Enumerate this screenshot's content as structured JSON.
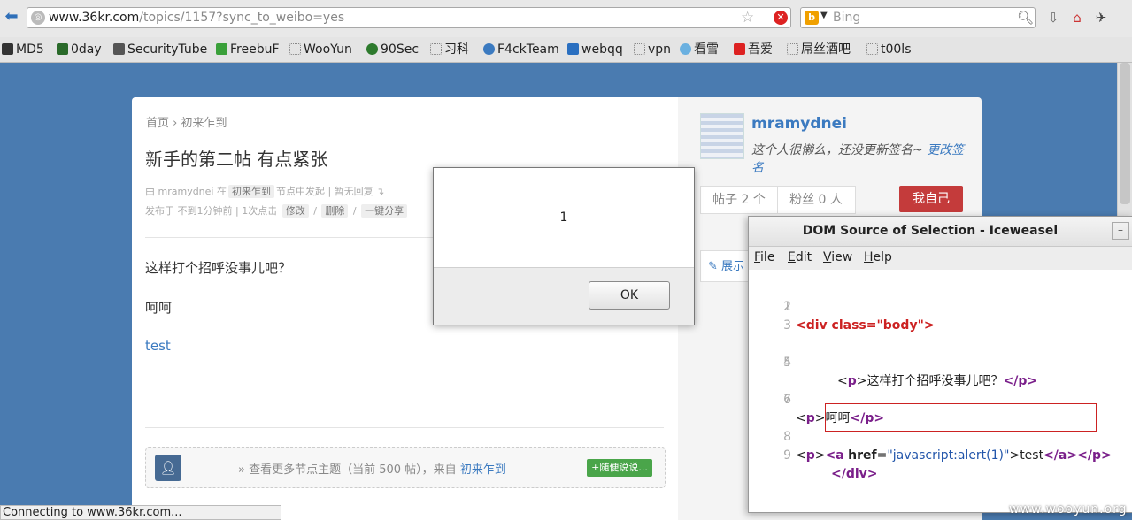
{
  "browser": {
    "url_host": "www.36kr.com",
    "url_path": "/topics/1157?sync_to_weibo=yes",
    "search_engine": "Bing",
    "bookmarks": [
      "MD5",
      "0day",
      "SecurityTube",
      "FreebuF",
      "WooYun",
      "90Sec",
      "习科",
      "F4ckTeam",
      "webqq",
      "vpn",
      "看雪",
      "吾爱",
      "屌丝酒吧",
      "t00ls"
    ],
    "status_text": "Connecting to www.36kr.com..."
  },
  "topic": {
    "breadcrumb": "首页 › 初来乍到",
    "title": "新手的第二帖 有点紧张",
    "meta_by": "由 mramydnei 在",
    "meta_node": "初来乍到",
    "meta_rest": "节点中发起 | 暂无回复 ↴",
    "meta_time": "发布于 不到1分钟前 | 1次点击",
    "edit": "修改",
    "delete": "删除",
    "share": "一键分享",
    "body_p1": "这样打个招呼没事儿吧？",
    "body_p2": "呵呵",
    "body_link": "test",
    "more_text": "» 查看更多节点主题（当前 500 帖），来自",
    "more_node": "初来乍到",
    "more_button": "+随便说说..."
  },
  "sidebar": {
    "username": "mramydnei",
    "signature": "这个人很懒么，还没更新签名~",
    "signature_link": "更改签名",
    "posts": "帖子 2 个",
    "fans": "粉丝 0 人",
    "me_button": "我自己",
    "show": "展示"
  },
  "alert": {
    "message": "1",
    "ok": "OK"
  },
  "dom_source": {
    "title": "DOM Source of Selection - Iceweasel",
    "menu": [
      "File",
      "Edit",
      "View",
      "Help"
    ],
    "menu_keys": [
      "F",
      "E",
      "V",
      "H"
    ],
    "line_numbers": [
      "1",
      "2",
      "3",
      "4",
      "5",
      "6",
      "7",
      "8",
      "9"
    ],
    "l1_tag": "<div class=\"body\">",
    "l4_text": "这样打个招呼没事儿吧？",
    "l6_text": "呵呵",
    "l8_href": "\"javascript:alert(1)\"",
    "l8_text": "test",
    "t_p_open": "<p>",
    "t_p_close": "</p>",
    "t_a_open": "<a",
    "t_a_attr": "href",
    "t_eq": "=",
    "t_gt": ">",
    "t_a_close": "</a>",
    "t_div_close": "</div>",
    "p_open_plain": "<",
    "p_name": "p",
    "p_gt": ">"
  },
  "watermark": "www.wooyun.org",
  "colors": {
    "page_bg": "#4a7bb0",
    "link": "#3b7ac0",
    "danger": "#c43b3b",
    "tag": "#7a1f8a"
  }
}
